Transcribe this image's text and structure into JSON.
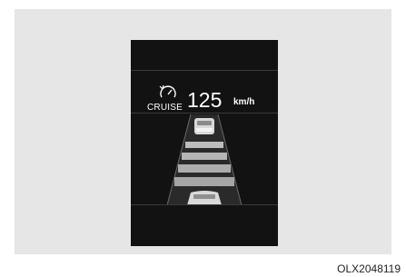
{
  "display": {
    "cruise_label": "CRUISE",
    "speed_value": "125",
    "speed_unit": "km/h",
    "cruise_icon": "cruise-speedometer-icon",
    "lead_vehicle_icon": "lead-vehicle-icon",
    "own_vehicle_icon": "own-vehicle-icon",
    "distance_level_bars": 4
  },
  "caption": {
    "code": "OLX2048119"
  },
  "colors": {
    "background": "#e6e6e6",
    "screen": "#121212",
    "text": "#ffffff",
    "bars": "#b5b5b5"
  }
}
